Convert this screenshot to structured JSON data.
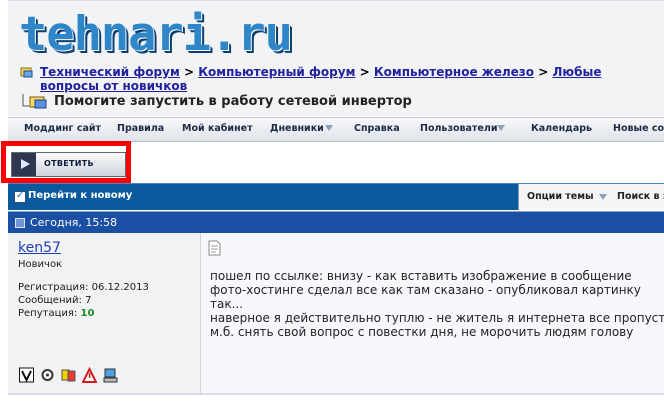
{
  "site": {
    "logo_text": "tehnari.ru"
  },
  "breadcrumb": {
    "items": [
      "Технический форум",
      "Компьютерный форум",
      "Компьютерное железо",
      "Любые вопросы от новичков"
    ],
    "separator": ">"
  },
  "thread": {
    "title": "Помогите запустить в работу сетевой инвертор"
  },
  "navbar": {
    "items": [
      "Моддинг сайт",
      "Правила",
      "Мой кабинет",
      "Дневники",
      "Справка",
      "Пользователи",
      "Календарь",
      "Новые сообщения"
    ]
  },
  "actions": {
    "reply_label": "ОТВЕТИТЬ"
  },
  "thread_tools": {
    "next_label": "Перейти к новому",
    "options_label": "Опции темы",
    "search_label": "Поиск в этой теме"
  },
  "post": {
    "date": "Сегодня, 15:58",
    "author": {
      "name": "ken57",
      "title": "Новичок",
      "registered_label": "Регистрация:",
      "registered": "06.12.2013",
      "messages_label": "Сообщений:",
      "messages": "7",
      "reputation_label": "Репутация:",
      "reputation": "10"
    },
    "lines": [
      "пошел по ссылке: внизу - как вставить изображение в сообщение",
      "фото-хостинге сделал все как там сказано - опубликовал картинку",
      "так...",
      "наверное я действительно туплю - не житель я интернета все пропустил",
      "м.б. снять свой вопрос с повестки дня, не морочить людям голову"
    ]
  },
  "colors": {
    "thread_bar": "#0b5a9d",
    "post_header": "#1a4fa3",
    "highlight": "#ff0000",
    "link": "#22229c",
    "reputation": "#1b8b2a"
  }
}
